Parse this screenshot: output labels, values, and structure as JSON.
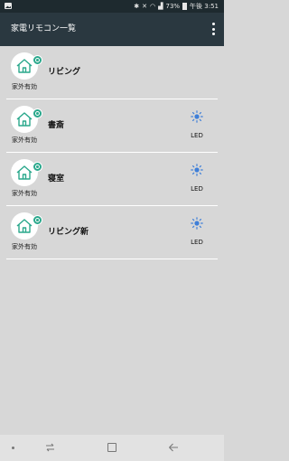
{
  "status_bar": {
    "battery": "73%",
    "time": "午後 3:51",
    "icons": [
      "gallery-icon",
      "bluetooth-icon",
      "mute-icon",
      "nfc-icon",
      "wifi-icon",
      "signal-icon",
      "battery-icon"
    ]
  },
  "app_bar": {
    "title": "家電リモコン一覧",
    "menu_icon": "overflow-menu-icon"
  },
  "rooms": [
    {
      "name": "リビング",
      "remote_status": "家外有効",
      "devices": []
    },
    {
      "name": "書斎",
      "remote_status": "家外有効",
      "devices": [
        {
          "label": "LED",
          "icon": "light-icon"
        }
      ]
    },
    {
      "name": "寝室",
      "remote_status": "家外有効",
      "devices": [
        {
          "label": "LED",
          "icon": "light-icon"
        }
      ]
    },
    {
      "name": "リビング新",
      "remote_status": "家外有効",
      "devices": [
        {
          "label": "LED",
          "icon": "light-icon"
        }
      ]
    }
  ],
  "colors": {
    "app_bar": "#2a3840",
    "status_bar": "#1e2a2f",
    "background": "#d7d7d7",
    "accent_green": "#2aa88c",
    "light_blue": "#3f7fd8"
  },
  "nav_bar": {
    "icons": [
      "dot-icon",
      "recent-apps-icon",
      "home-icon",
      "back-icon"
    ]
  }
}
